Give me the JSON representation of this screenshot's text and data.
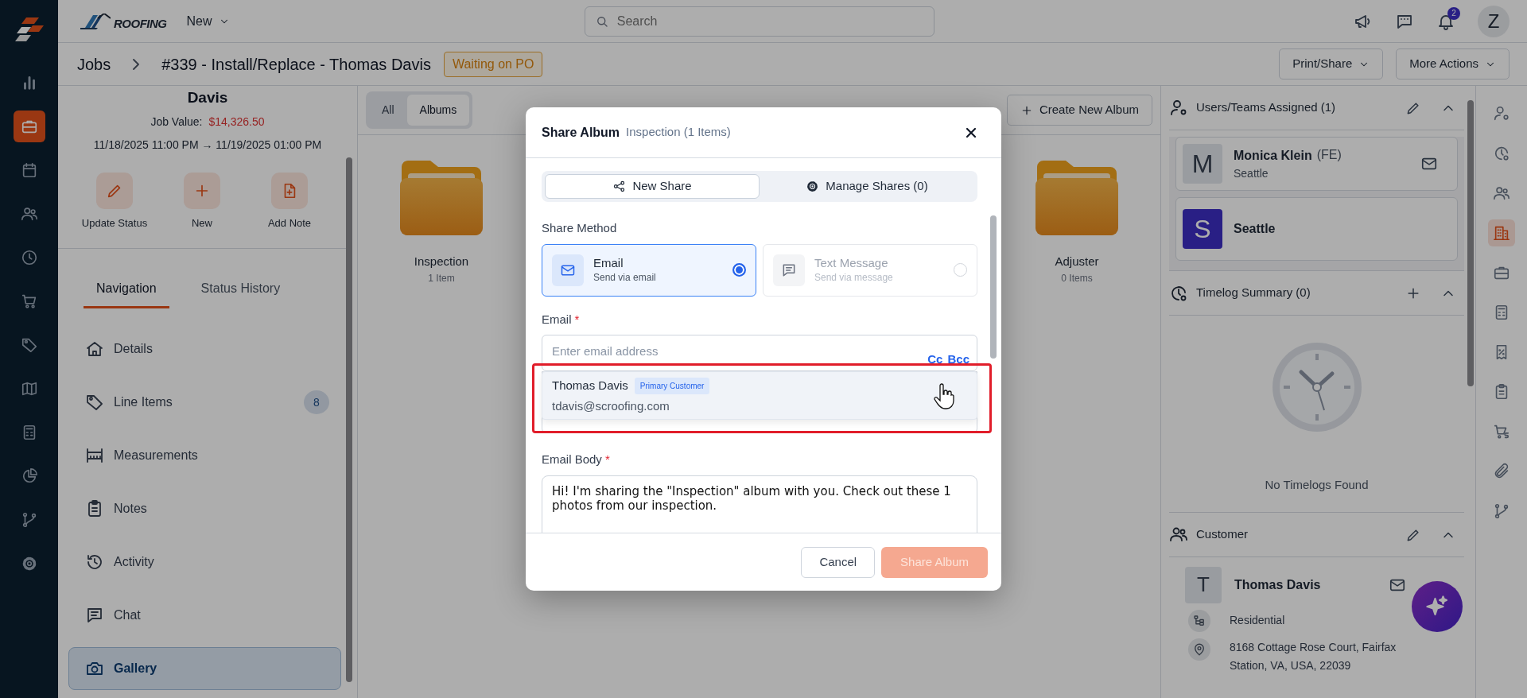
{
  "nav_rail": [
    {
      "selected": false
    },
    {
      "selected": true
    },
    {
      "selected": false
    },
    {
      "selected": false
    },
    {
      "selected": false
    },
    {
      "selected": false
    },
    {
      "selected": false
    },
    {
      "selected": false
    },
    {
      "selected": false
    },
    {
      "selected": false
    },
    {
      "selected": false
    },
    {
      "selected": false
    }
  ],
  "top_bar": {
    "brand": "ROOFING",
    "new_menu": "New",
    "search_placeholder": "Search",
    "notification_count": "2",
    "avatar": "Z"
  },
  "breadcrumb": {
    "items": [
      "Jobs",
      "#339 - Install/Replace - Thomas Davis"
    ],
    "status": "Waiting on PO",
    "actions": [
      "Print/Share",
      "More Actions"
    ]
  },
  "job": {
    "name": "Davis",
    "value_label": "Job Value:",
    "value": "$14,326.50",
    "dates": "11/18/2025 11:00 PM → 11/19/2025 01:00 PM",
    "quick_actions": [
      "Update Status",
      "New",
      "Add Note"
    ]
  },
  "panel_tabs": [
    {
      "label": "Navigation",
      "selected": true
    },
    {
      "label": "Status History",
      "selected": false
    }
  ],
  "nav_items": [
    {
      "label": "Details",
      "selected": false
    },
    {
      "label": "Line Items",
      "count": "8",
      "selected": false
    },
    {
      "label": "Measurements",
      "selected": false
    },
    {
      "label": "Notes",
      "selected": false
    },
    {
      "label": "Activity",
      "selected": false
    },
    {
      "label": "Chat",
      "selected": false
    },
    {
      "label": "Gallery",
      "selected": true
    }
  ],
  "gallery": {
    "filters": [
      {
        "label": "All",
        "selected": false
      },
      {
        "label": "Albums",
        "selected": true
      }
    ],
    "create_button": "Create New Album",
    "albums": [
      {
        "name": "Inspection",
        "count": "1 Item"
      },
      {
        "name": "Adjuster",
        "count": "0 Items"
      }
    ]
  },
  "right_panel": {
    "assigned": {
      "title": "Users/Teams Assigned (1)",
      "members": [
        {
          "kind": "user",
          "initial": "M",
          "name": "Monica Klein",
          "role": "(FE)",
          "location": "Seattle"
        },
        {
          "kind": "team",
          "initial": "S",
          "name": "Seattle"
        }
      ]
    },
    "timelog": {
      "title": "Timelog Summary (0)",
      "empty": "No Timelogs Found"
    },
    "customer": {
      "title": "Customer",
      "initial": "T",
      "name": "Thomas Davis",
      "type": "Residential",
      "address": "8168 Cottage Rose Court, Fairfax Station, VA, USA, 22039"
    }
  },
  "side_strip": [
    {
      "selected": false
    },
    {
      "selected": false
    },
    {
      "selected": false
    },
    {
      "selected": true
    },
    {
      "selected": false
    },
    {
      "selected": false
    },
    {
      "selected": false
    },
    {
      "selected": false
    },
    {
      "selected": false
    },
    {
      "selected": false
    },
    {
      "selected": false
    }
  ],
  "modal": {
    "title": "Share Album",
    "subtitle": "Inspection (1 Items)",
    "tabs": [
      {
        "label": "New Share",
        "selected": true
      },
      {
        "label": "Manage Shares (0)",
        "selected": false
      }
    ],
    "method_label": "Share Method",
    "methods": [
      {
        "title": "Email",
        "subtitle": "Send via email",
        "selected": true
      },
      {
        "title": "Text Message",
        "subtitle": "Send via message",
        "selected": false
      }
    ],
    "email_label": "Email",
    "required_mark": "*",
    "email_placeholder": "Enter email address",
    "cc": "Cc",
    "bcc": "Bcc",
    "suggestion": {
      "name": "Thomas Davis",
      "tag": "Primary Customer",
      "email": "tdavis@scroofing.com"
    },
    "body_label": "Email Body",
    "body": "Hi! I'm sharing the \"Inspection\" album with you. Check out these 1 photos from our inspection.",
    "cancel": "Cancel",
    "submit": {
      "label": "Share Album",
      "disabled": true
    }
  }
}
